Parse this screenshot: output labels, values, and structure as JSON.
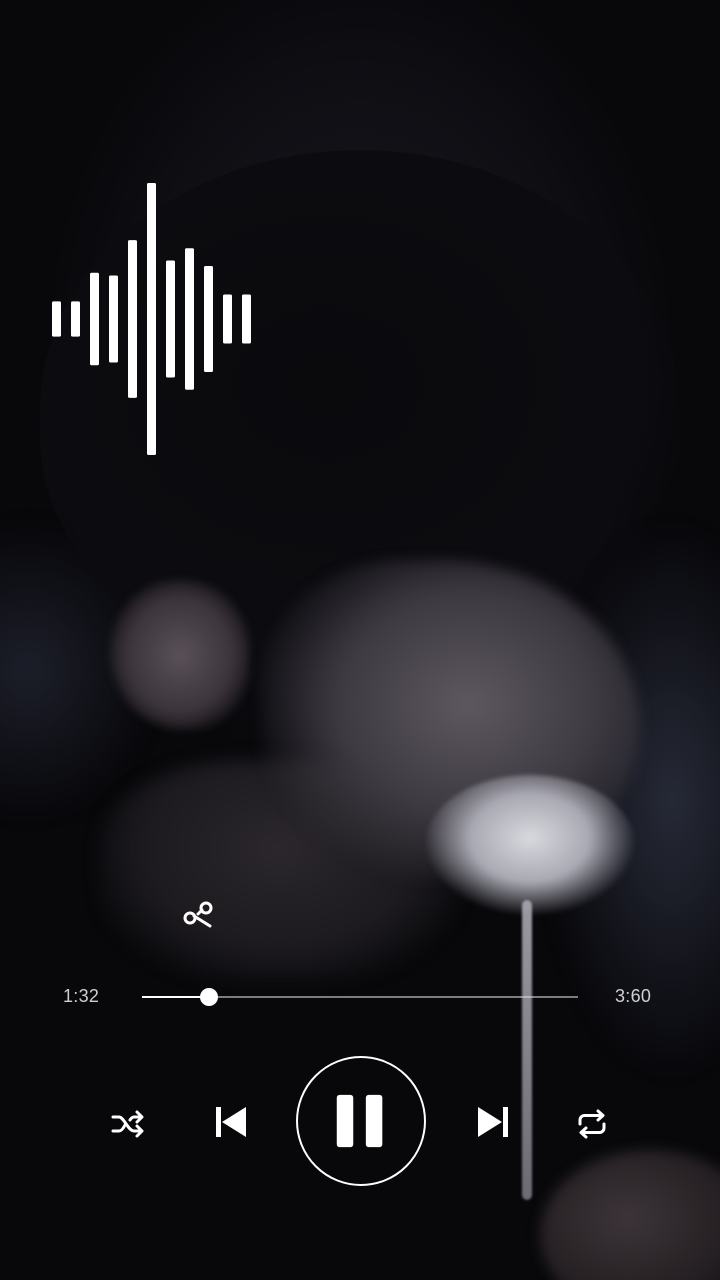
{
  "player": {
    "current_time": "1:32",
    "total_time": "3:60",
    "progress_fraction": 0.154,
    "is_playing": true
  },
  "waveform": {
    "bar_levels": [
      0.13,
      0.13,
      0.34,
      0.32,
      0.58,
      1.0,
      0.43,
      0.52,
      0.39,
      0.18,
      0.18
    ]
  },
  "controls": {
    "shuffle_icon": "shuffle-icon",
    "previous_icon": "skip-previous-icon",
    "pause_icon": "pause-icon",
    "next_icon": "skip-next-icon",
    "repeat_icon": "repeat-icon"
  },
  "colors": {
    "foreground": "#ffffff",
    "background": "#0b0b10"
  }
}
